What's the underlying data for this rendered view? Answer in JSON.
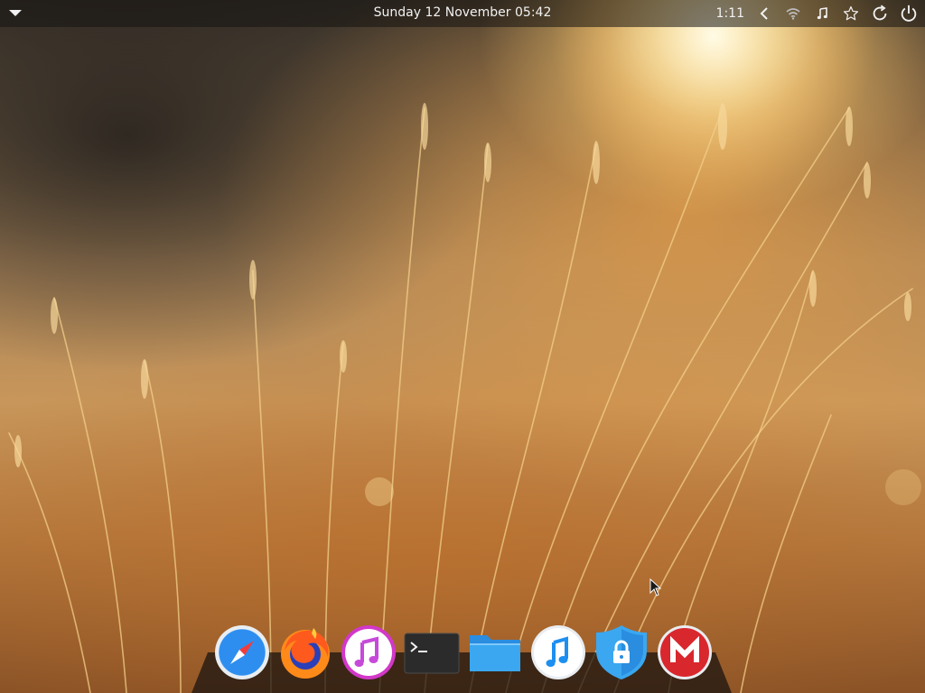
{
  "topbar": {
    "clock": "Sunday 12 November  05:42",
    "battery_time": "1:11",
    "icons": [
      "menu-down-icon",
      "chevron-left-icon",
      "wifi-icon",
      "music-note-icon",
      "star-icon",
      "refresh-icon",
      "power-icon"
    ]
  },
  "dock": {
    "apps": [
      {
        "name": "safari-icon"
      },
      {
        "name": "firefox-icon"
      },
      {
        "name": "itunes-pink-icon"
      },
      {
        "name": "terminal-icon"
      },
      {
        "name": "files-folder-icon"
      },
      {
        "name": "music-blue-icon"
      },
      {
        "name": "vpn-shield-icon"
      },
      {
        "name": "mega-icon"
      }
    ]
  },
  "colors": {
    "topbar_bg": "#1a1816",
    "mega_red": "#d9272e",
    "folder_blue": "#3aa7f0",
    "shield_blue": "#2a8de0",
    "itunes_pink": "#d238c8"
  }
}
